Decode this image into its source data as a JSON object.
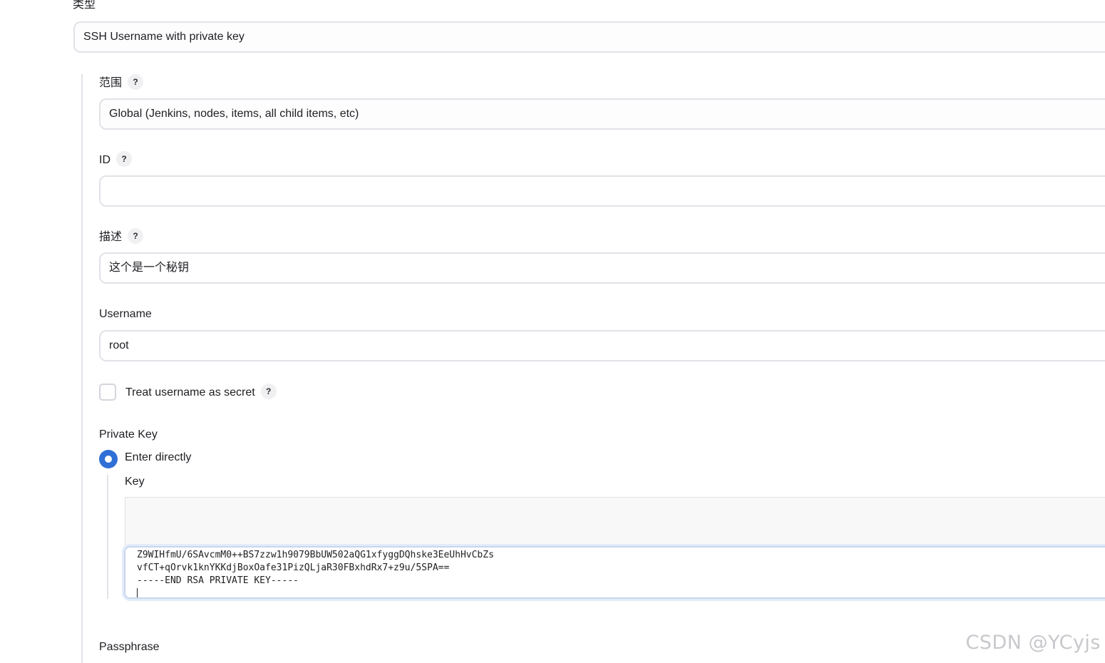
{
  "form": {
    "type": {
      "label": "类型",
      "value": "SSH Username with private key"
    },
    "scope": {
      "label": "范围",
      "help": "?",
      "value": "Global (Jenkins, nodes, items, all child items, etc)"
    },
    "id": {
      "label": "ID",
      "help": "?",
      "value": ""
    },
    "description": {
      "label": "描述",
      "help": "?",
      "value": "这个是一个秘钥"
    },
    "username": {
      "label": "Username",
      "value": "root"
    },
    "treat_secret": {
      "label": "Treat username as secret",
      "help": "?",
      "checked": false
    },
    "private_key": {
      "label": "Private Key",
      "option_label": "Enter directly",
      "selected": true,
      "key_label": "Key",
      "key_lines": [
        "Z9WIHfmU/6SAvcmM0++BS7zzw1h9079BbUW502aQG1xfyggDQhske3EeUhHvCbZs",
        "vfCT+qOrvk1knYKKdjBoxOafe31PizQLjaR30FBxhdRx7+z9u/5SPA==",
        "-----END RSA PRIVATE KEY-----"
      ]
    },
    "passphrase": {
      "label": "Passphrase"
    }
  },
  "watermark": "CSDN @YCyjs",
  "colors": {
    "accent": "#2f6fd6",
    "border": "#e2e2e8",
    "help_bg": "#f0f0f2"
  }
}
